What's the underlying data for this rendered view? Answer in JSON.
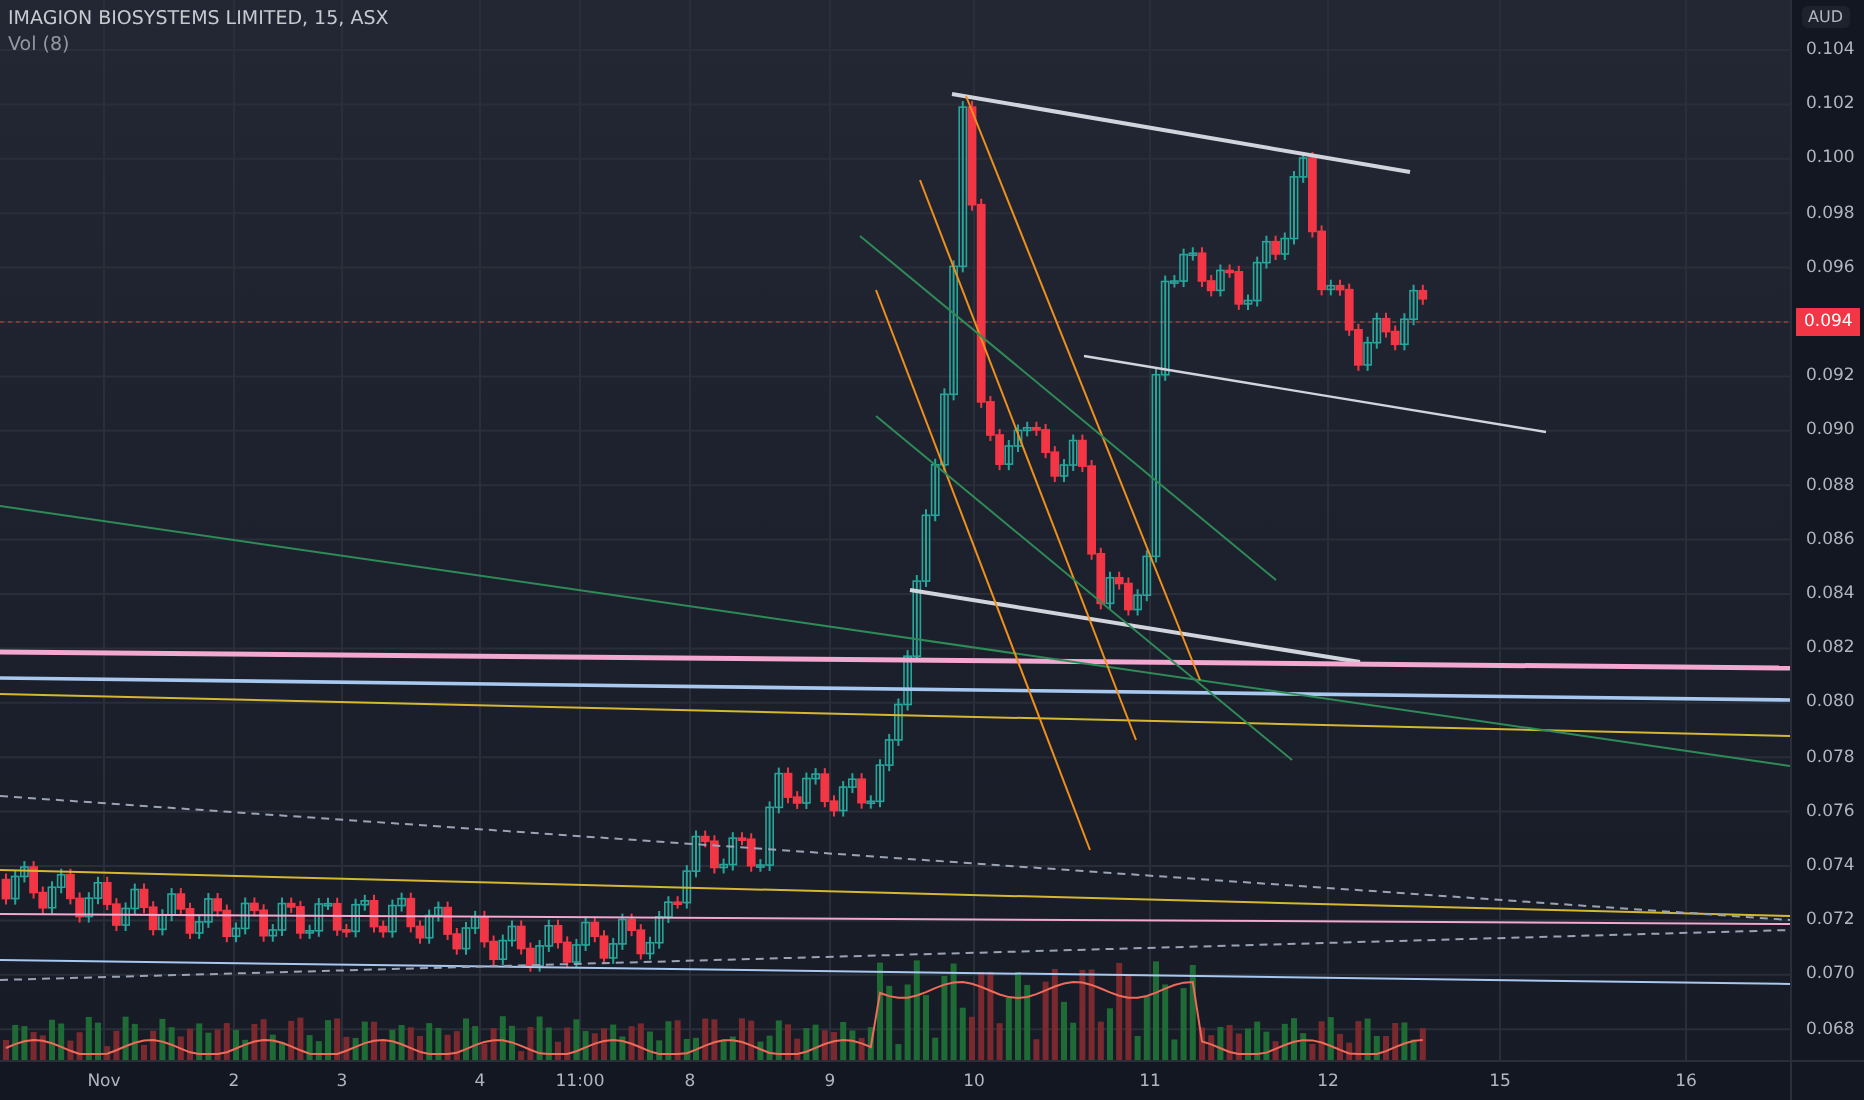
{
  "legend": {
    "symbol": "IMAGION BIOSYSTEMS LIMITED, 15, ASX",
    "indicator": "Vol (8)"
  },
  "price_axis": {
    "currency": "AUD",
    "last_price": "0.094",
    "ticks": [
      "0.104",
      "0.102",
      "0.100",
      "0.098",
      "0.096",
      "0.092",
      "0.090",
      "0.088",
      "0.086",
      "0.084",
      "0.082",
      "0.080",
      "0.078",
      "0.076",
      "0.074",
      "0.072",
      "0.070",
      "0.068"
    ]
  },
  "time_axis": {
    "ticks": [
      "Nov",
      "2",
      "3",
      "4",
      "11:00",
      "8",
      "9",
      "10",
      "11",
      "12",
      "15",
      "16"
    ]
  }
}
